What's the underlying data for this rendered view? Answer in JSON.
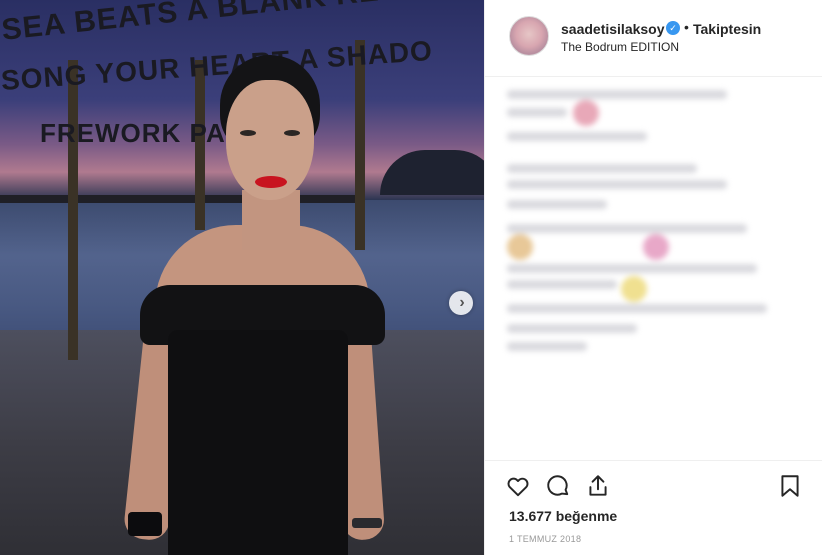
{
  "photo": {
    "sign_lines": [
      "SEA BEATS A BLANK REMEMBI",
      "SONG YOUR HEART A SHADO",
      "FREWORK PA   HUTE"
    ]
  },
  "post": {
    "username": "saadetisilaksoy",
    "separator": "•",
    "follow_label": "Takiptesin",
    "location": "The Bodrum EDITION",
    "likes": "13.677 beğenme",
    "date": "1 TEMMUZ 2018"
  },
  "icons": {
    "verified": "verified-badge-icon",
    "like": "heart-icon",
    "comment": "comment-icon",
    "share": "share-icon",
    "save": "bookmark-icon",
    "next": "chevron-right-icon"
  },
  "colors": {
    "accent": "#3897f0",
    "lipstick": "#c8141f"
  }
}
